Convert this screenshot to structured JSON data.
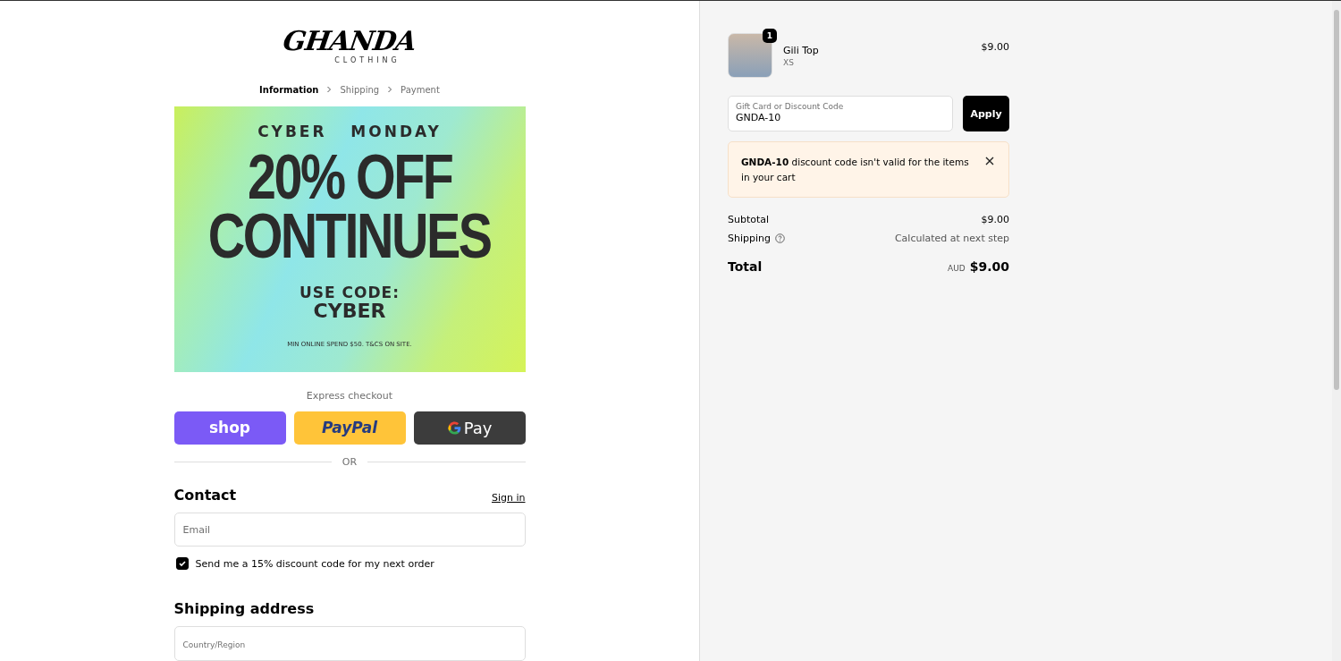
{
  "logo": {
    "name": "GHANDA",
    "tagline": "CLOTHING"
  },
  "breadcrumbs": [
    {
      "label": "Information",
      "selected": true
    },
    {
      "label": "Shipping",
      "selected": false
    },
    {
      "label": "Payment",
      "selected": false
    }
  ],
  "banner": {
    "kicker": "CYBER   MONDAY",
    "headline": [
      "20% OFF",
      "CONTINUES"
    ],
    "code_label": "USE CODE:",
    "code": "CYBER",
    "fine_print": "MIN ONLINE SPEND $50. T&CS ON SITE."
  },
  "express_checkout": {
    "title": "Express checkout",
    "buttons": [
      {
        "kind": "shop",
        "label": "shop"
      },
      {
        "kind": "paypal",
        "label": "PayPal"
      },
      {
        "kind": "gpay",
        "label": "Pay"
      }
    ]
  },
  "divider_label": "OR",
  "contact": {
    "title": "Contact",
    "sign_in": "Sign in",
    "email_placeholder": "Email",
    "marketing": {
      "label": "Send me a 15% discount code for my next order",
      "checked": true
    }
  },
  "shipping_address": {
    "title": "Shipping address",
    "country_label": "Country/Region"
  },
  "order_summary": {
    "items": [
      {
        "name": "Gili Top",
        "variant": "XS",
        "quantity": "1",
        "price": "$9.00"
      }
    ],
    "discount": {
      "label": "Gift Card or Discount Code",
      "value": "GNDA-10",
      "button": "Apply"
    },
    "error": {
      "message": "**GNDA-10** discount code isn't valid for the items in your cart"
    },
    "subtotal": {
      "label": "Subtotal",
      "value": "$9.00"
    },
    "shipping": {
      "label": "Shipping",
      "value": "Calculated at next step"
    },
    "total": {
      "label": "Total",
      "currency": "AUD",
      "value": "$9.00"
    }
  }
}
